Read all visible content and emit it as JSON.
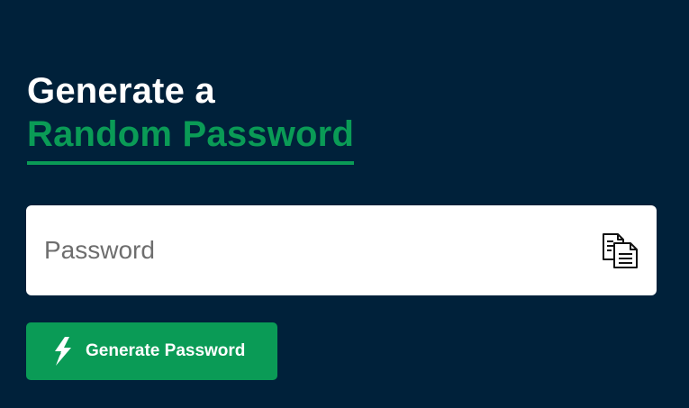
{
  "heading": {
    "line1": "Generate a",
    "line2": "Random Password"
  },
  "password_field": {
    "value": "",
    "placeholder": "Password",
    "copy_icon": "copy-icon"
  },
  "generate_button": {
    "label": "Generate Password",
    "icon": "lightning-bolt-icon"
  },
  "colors": {
    "background": "#00213a",
    "accent": "#0a9b56",
    "field_background": "#ffffff",
    "heading_text": "#ffffff"
  }
}
